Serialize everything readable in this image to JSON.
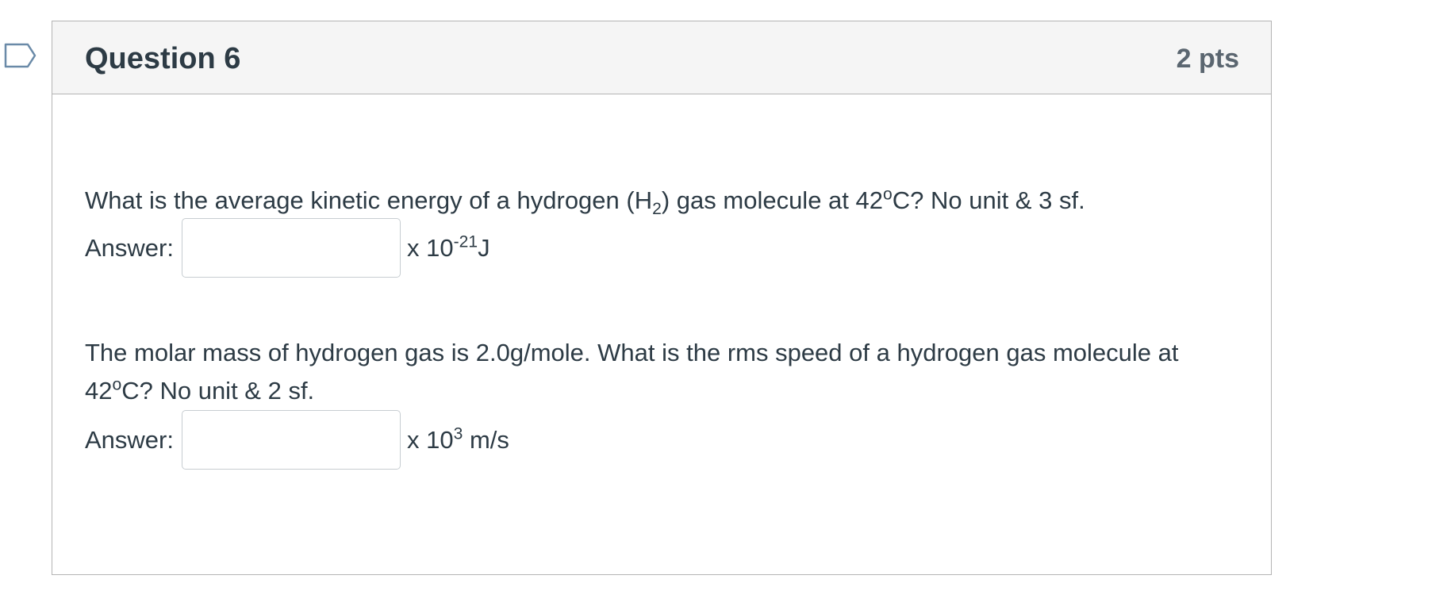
{
  "question": {
    "title": "Question 6",
    "points": "2 pts"
  },
  "part1": {
    "prompt_before": "What is the average kinetic energy of a hydrogen (H",
    "subscript": "2",
    "prompt_after": ") gas molecule at 42",
    "degree": "o",
    "prompt_end": "C? No unit & 3 sf.",
    "answer_label": "Answer:",
    "input_value": "",
    "unit_prefix": "x 10",
    "unit_exponent": "-21",
    "unit_suffix": "J"
  },
  "part2": {
    "prompt_before": "The molar mass of hydrogen gas is 2.0g/mole. What is the rms speed of a hydrogen gas molecule at 42",
    "degree": "o",
    "prompt_end": "C? No unit & 2 sf.",
    "answer_label": "Answer:",
    "input_value": "",
    "unit_prefix": "x 10",
    "unit_exponent": "3",
    "unit_suffix": " m/s"
  },
  "icons": {
    "flag": "bookmark-flag-icon"
  },
  "colors": {
    "text": "#2d3b45",
    "points_text": "#5b6670",
    "header_bg": "#f5f5f5",
    "border": "#b4b4b4",
    "flag_outline": "#6a8aa8"
  }
}
